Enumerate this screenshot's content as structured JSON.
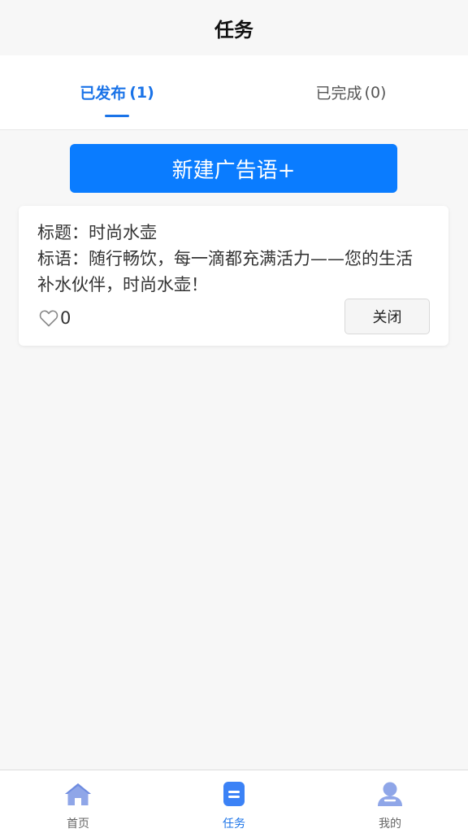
{
  "navbar": {
    "title": "任务"
  },
  "tabs": [
    {
      "label": "已发布",
      "count": "(1)",
      "active": true
    },
    {
      "label": "已完成",
      "count": "(0)",
      "active": false
    }
  ],
  "new_button": {
    "label": "新建广告语+"
  },
  "cards": [
    {
      "title_line": "标题：时尚水壶",
      "slogan_line": "标语：随行畅饮，每一滴都充满活力——您的生活补水伙伴，时尚水壶！",
      "likes": "0",
      "close_label": "关闭"
    }
  ],
  "bottom_nav": [
    {
      "label": "首页",
      "icon": "home-icon",
      "active": false
    },
    {
      "label": "任务",
      "icon": "task-icon",
      "active": true
    },
    {
      "label": "我的",
      "icon": "user-icon",
      "active": false
    }
  ],
  "colors": {
    "accent": "#1a73e8",
    "button": "#0a7cff",
    "background": "#f7f7f7"
  }
}
